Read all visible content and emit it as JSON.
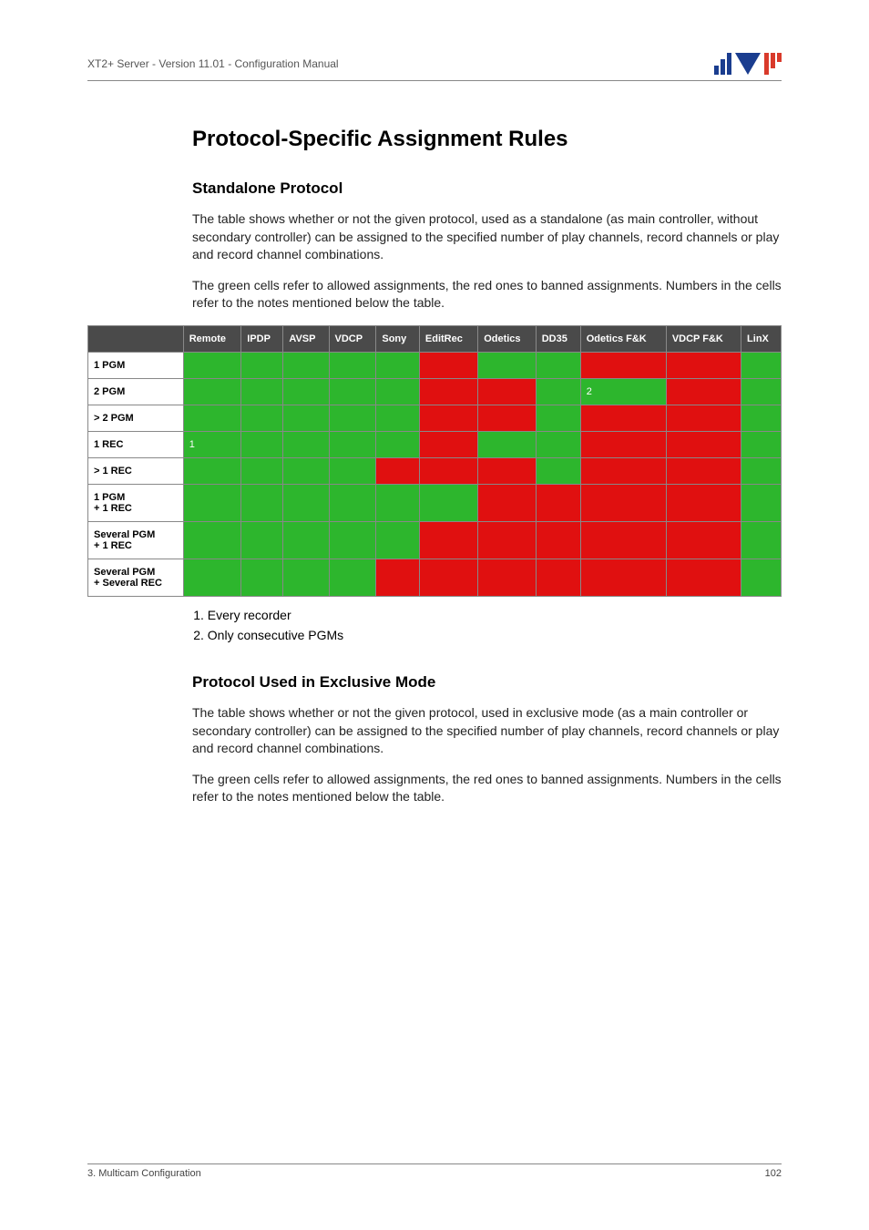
{
  "header": {
    "doc_title": "XT2+ Server - Version 11.01 - Configuration Manual"
  },
  "title": "Protocol-Specific Assignment Rules",
  "section1": {
    "heading": "Standalone Protocol",
    "p1": "The table shows whether or not the given protocol, used as a standalone (as main controller, without secondary controller) can be assigned to the specified number of play channels, record channels or play and record channel combinations.",
    "p2": "The green cells refer to allowed assignments, the red ones to banned assignments. Numbers in the cells refer to the notes mentioned below the table."
  },
  "table": {
    "columns": [
      "Remote",
      "IPDP",
      "AVSP",
      "VDCP",
      "Sony",
      "EditRec",
      "Odetics",
      "DD35",
      "Odetics F&K",
      "VDCP F&K",
      "LinX"
    ],
    "rows": [
      {
        "label": "1 PGM",
        "cells": [
          {
            "s": "g"
          },
          {
            "s": "g"
          },
          {
            "s": "g"
          },
          {
            "s": "g"
          },
          {
            "s": "g"
          },
          {
            "s": "r"
          },
          {
            "s": "g"
          },
          {
            "s": "g"
          },
          {
            "s": "r"
          },
          {
            "s": "r"
          },
          {
            "s": "g"
          }
        ]
      },
      {
        "label": "2 PGM",
        "cells": [
          {
            "s": "g"
          },
          {
            "s": "g"
          },
          {
            "s": "g"
          },
          {
            "s": "g"
          },
          {
            "s": "g"
          },
          {
            "s": "r"
          },
          {
            "s": "r"
          },
          {
            "s": "g"
          },
          {
            "s": "g",
            "v": "2"
          },
          {
            "s": "r"
          },
          {
            "s": "g"
          }
        ]
      },
      {
        "label": "> 2 PGM",
        "cells": [
          {
            "s": "g"
          },
          {
            "s": "g"
          },
          {
            "s": "g"
          },
          {
            "s": "g"
          },
          {
            "s": "g"
          },
          {
            "s": "r"
          },
          {
            "s": "r"
          },
          {
            "s": "g"
          },
          {
            "s": "r"
          },
          {
            "s": "r"
          },
          {
            "s": "g"
          }
        ]
      },
      {
        "label": "1 REC",
        "cells": [
          {
            "s": "g",
            "v": "1"
          },
          {
            "s": "g"
          },
          {
            "s": "g"
          },
          {
            "s": "g"
          },
          {
            "s": "g"
          },
          {
            "s": "r"
          },
          {
            "s": "g"
          },
          {
            "s": "g"
          },
          {
            "s": "r"
          },
          {
            "s": "r"
          },
          {
            "s": "g"
          }
        ]
      },
      {
        "label": "> 1 REC",
        "cells": [
          {
            "s": "g"
          },
          {
            "s": "g"
          },
          {
            "s": "g"
          },
          {
            "s": "g"
          },
          {
            "s": "r"
          },
          {
            "s": "r"
          },
          {
            "s": "r"
          },
          {
            "s": "g"
          },
          {
            "s": "r"
          },
          {
            "s": "r"
          },
          {
            "s": "g"
          }
        ]
      },
      {
        "label": "1 PGM\n+ 1 REC",
        "cells": [
          {
            "s": "g"
          },
          {
            "s": "g"
          },
          {
            "s": "g"
          },
          {
            "s": "g"
          },
          {
            "s": "g"
          },
          {
            "s": "g"
          },
          {
            "s": "r"
          },
          {
            "s": "r"
          },
          {
            "s": "r"
          },
          {
            "s": "r"
          },
          {
            "s": "g"
          }
        ]
      },
      {
        "label": "Several PGM\n+ 1 REC",
        "cells": [
          {
            "s": "g"
          },
          {
            "s": "g"
          },
          {
            "s": "g"
          },
          {
            "s": "g"
          },
          {
            "s": "g"
          },
          {
            "s": "r"
          },
          {
            "s": "r"
          },
          {
            "s": "r"
          },
          {
            "s": "r"
          },
          {
            "s": "r"
          },
          {
            "s": "g"
          }
        ]
      },
      {
        "label": "Several PGM\n+ Several REC",
        "cells": [
          {
            "s": "g"
          },
          {
            "s": "g"
          },
          {
            "s": "g"
          },
          {
            "s": "g"
          },
          {
            "s": "r"
          },
          {
            "s": "r"
          },
          {
            "s": "r"
          },
          {
            "s": "r"
          },
          {
            "s": "r"
          },
          {
            "s": "r"
          },
          {
            "s": "g"
          }
        ]
      }
    ],
    "notes": [
      "Every recorder",
      "Only consecutive PGMs"
    ]
  },
  "section2": {
    "heading": "Protocol Used in Exclusive Mode",
    "p1": "The table shows whether or not the given protocol, used in exclusive mode (as a main controller or secondary controller) can be assigned to the specified number of play channels, record channels or play and record channel combinations.",
    "p2": "The green cells refer to allowed assignments, the red ones to banned assignments. Numbers in the cells refer to the notes mentioned below the table."
  },
  "footer": {
    "left": "3. Multicam Configuration",
    "right": "102"
  }
}
